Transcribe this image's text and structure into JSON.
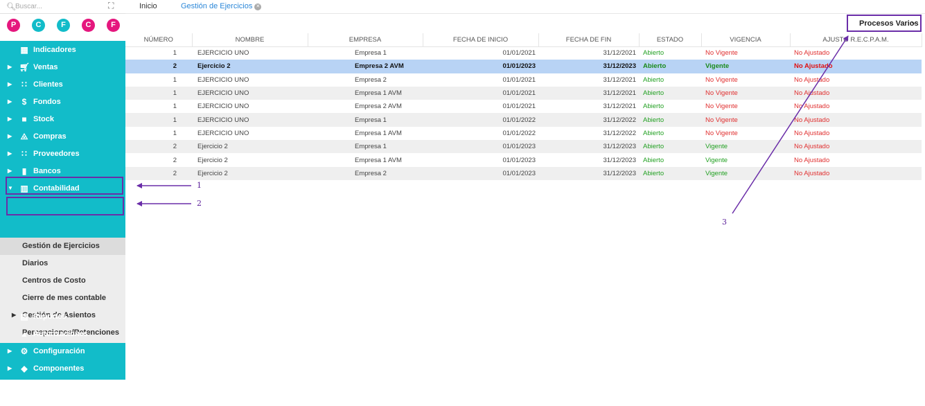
{
  "search": {
    "placeholder": "Buscar..."
  },
  "avatars": [
    {
      "letter": "P",
      "color": "#e5177e"
    },
    {
      "letter": "C",
      "color": "#12bcc9"
    },
    {
      "letter": "F",
      "color": "#12bcc9"
    },
    {
      "letter": "C",
      "color": "#e5177e"
    },
    {
      "letter": "F",
      "color": "#e5177e"
    }
  ],
  "sidebar": {
    "items": [
      {
        "label": "Indicadores",
        "icon": "dashboard-icon"
      },
      {
        "label": "Ventas",
        "icon": "cart-icon"
      },
      {
        "label": "Clientes",
        "icon": "people-icon"
      },
      {
        "label": "Fondos",
        "icon": "dollar-icon"
      },
      {
        "label": "Stock",
        "icon": "box-icon"
      },
      {
        "label": "Compras",
        "icon": "basket-icon"
      },
      {
        "label": "Proveedores",
        "icon": "people-icon"
      },
      {
        "label": "Bancos",
        "icon": "briefcase-icon"
      },
      {
        "label": "Contabilidad",
        "icon": "book-icon"
      }
    ],
    "submenu": [
      "Gestión de Ejercicios",
      "Diarios",
      "Centros de Costo",
      "Cierre de mes contable",
      "Gestión de Asientos",
      "Percepciones/Retenciones"
    ],
    "bottom_items": [
      {
        "label": "Reportes",
        "icon": "report-icon"
      },
      {
        "label": "Autorizaciones",
        "icon": "lock-icon"
      },
      {
        "label": "Configuración",
        "icon": "gears-icon"
      },
      {
        "label": "Componentes",
        "icon": "tag-icon"
      }
    ]
  },
  "tabs": {
    "home": "Inicio",
    "active": "Gestión de Ejercicios"
  },
  "toolbar": {
    "procesos_label": "Procesos Varios"
  },
  "table": {
    "headers": [
      "NÚMERO",
      "NOMBRE",
      "EMPRESA",
      "FECHA DE INICIO",
      "FECHA DE FIN",
      "ESTADO",
      "VIGENCIA",
      "AJUSTO R.E.C.P.A.M."
    ],
    "rows": [
      [
        "1",
        "EJERCICIO UNO",
        "Empresa 1",
        "01/01/2021",
        "31/12/2021",
        "Abierto",
        "No Vigente",
        "No Ajustado"
      ],
      [
        "2",
        "Ejercicio 2",
        "Empresa 2 AVM",
        "01/01/2023",
        "31/12/2023",
        "Abierto",
        "Vigente",
        "No Ajustado"
      ],
      [
        "1",
        "EJERCICIO UNO",
        "Empresa 2",
        "01/01/2021",
        "31/12/2021",
        "Abierto",
        "No Vigente",
        "No Ajustado"
      ],
      [
        "1",
        "EJERCICIO UNO",
        "Empresa 1 AVM",
        "01/01/2021",
        "31/12/2021",
        "Abierto",
        "No Vigente",
        "No Ajustado"
      ],
      [
        "1",
        "EJERCICIO UNO",
        "Empresa 2 AVM",
        "01/01/2021",
        "31/12/2021",
        "Abierto",
        "No Vigente",
        "No Ajustado"
      ],
      [
        "1",
        "EJERCICIO UNO",
        "Empresa 1",
        "01/01/2022",
        "31/12/2022",
        "Abierto",
        "No Vigente",
        "No Ajustado"
      ],
      [
        "1",
        "EJERCICIO UNO",
        "Empresa 1 AVM",
        "01/01/2022",
        "31/12/2022",
        "Abierto",
        "No Vigente",
        "No Ajustado"
      ],
      [
        "2",
        "Ejercicio 2",
        "Empresa 1",
        "01/01/2023",
        "31/12/2023",
        "Abierto",
        "Vigente",
        "No Ajustado"
      ],
      [
        "2",
        "Ejercicio 2",
        "Empresa 1 AVM",
        "01/01/2023",
        "31/12/2023",
        "Abierto",
        "Vigente",
        "No Ajustado"
      ],
      [
        "2",
        "Ejercicio 2",
        "Empresa 2",
        "01/01/2023",
        "31/12/2023",
        "Abierto",
        "Vigente",
        "No Ajustado"
      ]
    ],
    "selected_row": 1
  },
  "annotations": [
    "1",
    "2",
    "3"
  ],
  "colors": {
    "accent": "#12bcc9",
    "annotation": "#6a2da8",
    "pink": "#e5177e",
    "selected_row": "#b8d3f5"
  }
}
